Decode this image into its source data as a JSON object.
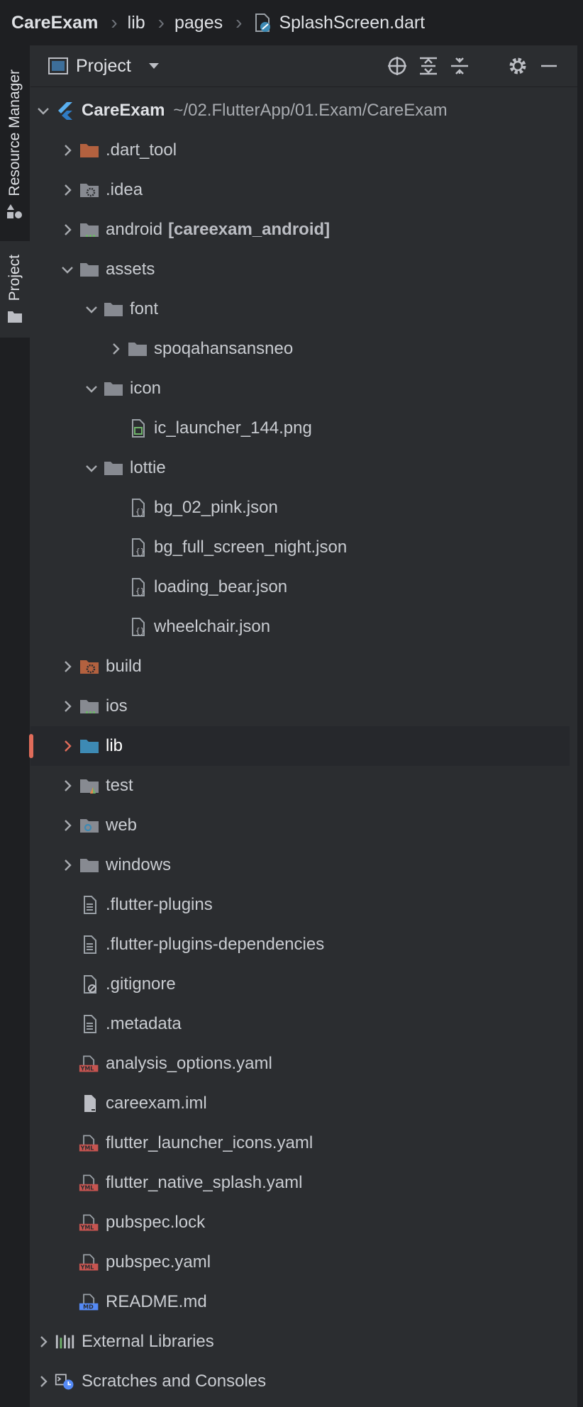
{
  "breadcrumb": {
    "root": "CareExam",
    "items": [
      "lib",
      "pages",
      "SplashScreen.dart"
    ]
  },
  "sidebar_tabs": [
    "Resource Manager",
    "Project"
  ],
  "toolbar": {
    "title": "Project"
  },
  "tree": [
    {
      "label": "CareExam",
      "path": "~/02.FlutterApp/01.Exam/CareExam",
      "indent": 0,
      "chevron": "down",
      "icon": "flutter-icon"
    },
    {
      "label": ".dart_tool",
      "indent": 1,
      "chevron": "right",
      "icon": "folder-excluded-icon"
    },
    {
      "label": ".idea",
      "indent": 1,
      "chevron": "right",
      "icon": "folder-config-icon"
    },
    {
      "label": "android",
      "module": "[careexam_android]",
      "indent": 1,
      "chevron": "right",
      "icon": "folder-module-icon"
    },
    {
      "label": "assets",
      "indent": 1,
      "chevron": "down",
      "icon": "folder-icon"
    },
    {
      "label": "font",
      "indent": 2,
      "chevron": "down",
      "icon": "folder-icon"
    },
    {
      "label": "spoqahansansneo",
      "indent": 3,
      "chevron": "right",
      "icon": "folder-icon"
    },
    {
      "label": "icon",
      "indent": 2,
      "chevron": "down",
      "icon": "folder-icon"
    },
    {
      "label": "ic_launcher_144.png",
      "indent": 3,
      "chevron": "none",
      "icon": "image-file-icon"
    },
    {
      "label": "lottie",
      "indent": 2,
      "chevron": "down",
      "icon": "folder-icon"
    },
    {
      "label": "bg_02_pink.json",
      "indent": 3,
      "chevron": "none",
      "icon": "json-file-icon"
    },
    {
      "label": "bg_full_screen_night.json",
      "indent": 3,
      "chevron": "none",
      "icon": "json-file-icon"
    },
    {
      "label": "loading_bear.json",
      "indent": 3,
      "chevron": "none",
      "icon": "json-file-icon"
    },
    {
      "label": "wheelchair.json",
      "indent": 3,
      "chevron": "none",
      "icon": "json-file-icon"
    },
    {
      "label": "build",
      "indent": 1,
      "chevron": "right",
      "icon": "folder-excluded-config-icon"
    },
    {
      "label": "ios",
      "indent": 1,
      "chevron": "right",
      "icon": "folder-module-icon"
    },
    {
      "label": "lib",
      "indent": 1,
      "chevron": "right",
      "icon": "folder-source-icon",
      "selected": true
    },
    {
      "label": "test",
      "indent": 1,
      "chevron": "right",
      "icon": "folder-test-icon"
    },
    {
      "label": "web",
      "indent": 1,
      "chevron": "right",
      "icon": "folder-web-icon"
    },
    {
      "label": "windows",
      "indent": 1,
      "chevron": "right",
      "icon": "folder-icon"
    },
    {
      "label": ".flutter-plugins",
      "indent": 1,
      "chevron": "none",
      "icon": "text-file-icon"
    },
    {
      "label": ".flutter-plugins-dependencies",
      "indent": 1,
      "chevron": "none",
      "icon": "text-file-icon"
    },
    {
      "label": ".gitignore",
      "indent": 1,
      "chevron": "none",
      "icon": "ignore-file-icon"
    },
    {
      "label": ".metadata",
      "indent": 1,
      "chevron": "none",
      "icon": "text-file-icon"
    },
    {
      "label": "analysis_options.yaml",
      "indent": 1,
      "chevron": "none",
      "icon": "yaml-file-icon"
    },
    {
      "label": "careexam.iml",
      "indent": 1,
      "chevron": "none",
      "icon": "iml-file-icon"
    },
    {
      "label": "flutter_launcher_icons.yaml",
      "indent": 1,
      "chevron": "none",
      "icon": "yaml-file-icon"
    },
    {
      "label": "flutter_native_splash.yaml",
      "indent": 1,
      "chevron": "none",
      "icon": "yaml-file-icon"
    },
    {
      "label": "pubspec.lock",
      "indent": 1,
      "chevron": "none",
      "icon": "yaml-file-icon"
    },
    {
      "label": "pubspec.yaml",
      "indent": 1,
      "chevron": "none",
      "icon": "yaml-file-icon"
    },
    {
      "label": "README.md",
      "indent": 1,
      "chevron": "none",
      "icon": "markdown-file-icon"
    },
    {
      "label": "External Libraries",
      "indent": 0,
      "chevron": "right",
      "icon": "libraries-icon"
    },
    {
      "label": "Scratches and Consoles",
      "indent": 0,
      "chevron": "right",
      "icon": "scratches-icon"
    }
  ],
  "colors": {
    "background": "#1e1f22",
    "panel": "#2b2d30",
    "folder": "#878a91",
    "folder_excluded": "#b3613f",
    "folder_source": "#3d8ab4",
    "selection_marker": "#e06c5a",
    "yaml_badge": "#c75450",
    "md_badge": "#548af7"
  }
}
